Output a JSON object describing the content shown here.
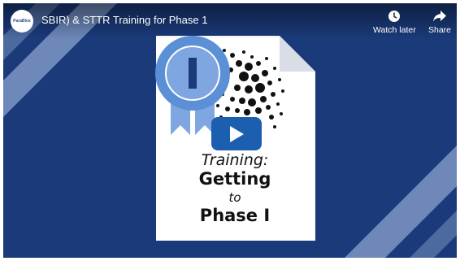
{
  "video": {
    "title": "SBIR) & STTR Training for Phase 1",
    "channel_avatar_text": "ParaBlox"
  },
  "actions": {
    "watch_later_label": "Watch later",
    "share_label": "Share"
  },
  "thumbnail": {
    "line1": "Training:",
    "line2": "Getting",
    "line3": "to",
    "line4": "Phase I",
    "badge_text": "I"
  },
  "colors": {
    "background_blue": "#1a3a7a",
    "badge_blue": "#5b8fd6",
    "play_button": "#1c5eb0"
  }
}
